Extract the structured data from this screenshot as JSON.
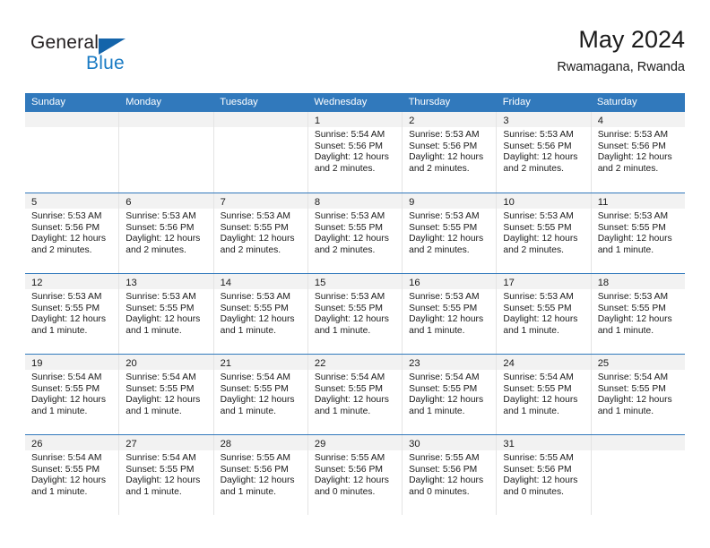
{
  "brand": {
    "name_dark": "General",
    "name_blue": "Blue",
    "dark_color": "#231f20",
    "blue_color": "#1a7bc4"
  },
  "header": {
    "title": "May 2024",
    "subtitle": "Rwamagana, Rwanda"
  },
  "theme": {
    "header_blue": "#3179bc",
    "day_band_gray": "#f2f2f2",
    "cell_border": "#e4e4e4"
  },
  "weekdays": [
    "Sunday",
    "Monday",
    "Tuesday",
    "Wednesday",
    "Thursday",
    "Friday",
    "Saturday"
  ],
  "weeks": [
    [
      {
        "day": "",
        "empty": true
      },
      {
        "day": "",
        "empty": true
      },
      {
        "day": "",
        "empty": true
      },
      {
        "day": "1",
        "sunrise": "Sunrise: 5:54 AM",
        "sunset": "Sunset: 5:56 PM",
        "daylight1": "Daylight: 12 hours",
        "daylight2": "and 2 minutes."
      },
      {
        "day": "2",
        "sunrise": "Sunrise: 5:53 AM",
        "sunset": "Sunset: 5:56 PM",
        "daylight1": "Daylight: 12 hours",
        "daylight2": "and 2 minutes."
      },
      {
        "day": "3",
        "sunrise": "Sunrise: 5:53 AM",
        "sunset": "Sunset: 5:56 PM",
        "daylight1": "Daylight: 12 hours",
        "daylight2": "and 2 minutes."
      },
      {
        "day": "4",
        "sunrise": "Sunrise: 5:53 AM",
        "sunset": "Sunset: 5:56 PM",
        "daylight1": "Daylight: 12 hours",
        "daylight2": "and 2 minutes."
      }
    ],
    [
      {
        "day": "5",
        "sunrise": "Sunrise: 5:53 AM",
        "sunset": "Sunset: 5:56 PM",
        "daylight1": "Daylight: 12 hours",
        "daylight2": "and 2 minutes."
      },
      {
        "day": "6",
        "sunrise": "Sunrise: 5:53 AM",
        "sunset": "Sunset: 5:56 PM",
        "daylight1": "Daylight: 12 hours",
        "daylight2": "and 2 minutes."
      },
      {
        "day": "7",
        "sunrise": "Sunrise: 5:53 AM",
        "sunset": "Sunset: 5:55 PM",
        "daylight1": "Daylight: 12 hours",
        "daylight2": "and 2 minutes."
      },
      {
        "day": "8",
        "sunrise": "Sunrise: 5:53 AM",
        "sunset": "Sunset: 5:55 PM",
        "daylight1": "Daylight: 12 hours",
        "daylight2": "and 2 minutes."
      },
      {
        "day": "9",
        "sunrise": "Sunrise: 5:53 AM",
        "sunset": "Sunset: 5:55 PM",
        "daylight1": "Daylight: 12 hours",
        "daylight2": "and 2 minutes."
      },
      {
        "day": "10",
        "sunrise": "Sunrise: 5:53 AM",
        "sunset": "Sunset: 5:55 PM",
        "daylight1": "Daylight: 12 hours",
        "daylight2": "and 2 minutes."
      },
      {
        "day": "11",
        "sunrise": "Sunrise: 5:53 AM",
        "sunset": "Sunset: 5:55 PM",
        "daylight1": "Daylight: 12 hours",
        "daylight2": "and 1 minute."
      }
    ],
    [
      {
        "day": "12",
        "sunrise": "Sunrise: 5:53 AM",
        "sunset": "Sunset: 5:55 PM",
        "daylight1": "Daylight: 12 hours",
        "daylight2": "and 1 minute."
      },
      {
        "day": "13",
        "sunrise": "Sunrise: 5:53 AM",
        "sunset": "Sunset: 5:55 PM",
        "daylight1": "Daylight: 12 hours",
        "daylight2": "and 1 minute."
      },
      {
        "day": "14",
        "sunrise": "Sunrise: 5:53 AM",
        "sunset": "Sunset: 5:55 PM",
        "daylight1": "Daylight: 12 hours",
        "daylight2": "and 1 minute."
      },
      {
        "day": "15",
        "sunrise": "Sunrise: 5:53 AM",
        "sunset": "Sunset: 5:55 PM",
        "daylight1": "Daylight: 12 hours",
        "daylight2": "and 1 minute."
      },
      {
        "day": "16",
        "sunrise": "Sunrise: 5:53 AM",
        "sunset": "Sunset: 5:55 PM",
        "daylight1": "Daylight: 12 hours",
        "daylight2": "and 1 minute."
      },
      {
        "day": "17",
        "sunrise": "Sunrise: 5:53 AM",
        "sunset": "Sunset: 5:55 PM",
        "daylight1": "Daylight: 12 hours",
        "daylight2": "and 1 minute."
      },
      {
        "day": "18",
        "sunrise": "Sunrise: 5:53 AM",
        "sunset": "Sunset: 5:55 PM",
        "daylight1": "Daylight: 12 hours",
        "daylight2": "and 1 minute."
      }
    ],
    [
      {
        "day": "19",
        "sunrise": "Sunrise: 5:54 AM",
        "sunset": "Sunset: 5:55 PM",
        "daylight1": "Daylight: 12 hours",
        "daylight2": "and 1 minute."
      },
      {
        "day": "20",
        "sunrise": "Sunrise: 5:54 AM",
        "sunset": "Sunset: 5:55 PM",
        "daylight1": "Daylight: 12 hours",
        "daylight2": "and 1 minute."
      },
      {
        "day": "21",
        "sunrise": "Sunrise: 5:54 AM",
        "sunset": "Sunset: 5:55 PM",
        "daylight1": "Daylight: 12 hours",
        "daylight2": "and 1 minute."
      },
      {
        "day": "22",
        "sunrise": "Sunrise: 5:54 AM",
        "sunset": "Sunset: 5:55 PM",
        "daylight1": "Daylight: 12 hours",
        "daylight2": "and 1 minute."
      },
      {
        "day": "23",
        "sunrise": "Sunrise: 5:54 AM",
        "sunset": "Sunset: 5:55 PM",
        "daylight1": "Daylight: 12 hours",
        "daylight2": "and 1 minute."
      },
      {
        "day": "24",
        "sunrise": "Sunrise: 5:54 AM",
        "sunset": "Sunset: 5:55 PM",
        "daylight1": "Daylight: 12 hours",
        "daylight2": "and 1 minute."
      },
      {
        "day": "25",
        "sunrise": "Sunrise: 5:54 AM",
        "sunset": "Sunset: 5:55 PM",
        "daylight1": "Daylight: 12 hours",
        "daylight2": "and 1 minute."
      }
    ],
    [
      {
        "day": "26",
        "sunrise": "Sunrise: 5:54 AM",
        "sunset": "Sunset: 5:55 PM",
        "daylight1": "Daylight: 12 hours",
        "daylight2": "and 1 minute."
      },
      {
        "day": "27",
        "sunrise": "Sunrise: 5:54 AM",
        "sunset": "Sunset: 5:55 PM",
        "daylight1": "Daylight: 12 hours",
        "daylight2": "and 1 minute."
      },
      {
        "day": "28",
        "sunrise": "Sunrise: 5:55 AM",
        "sunset": "Sunset: 5:56 PM",
        "daylight1": "Daylight: 12 hours",
        "daylight2": "and 1 minute."
      },
      {
        "day": "29",
        "sunrise": "Sunrise: 5:55 AM",
        "sunset": "Sunset: 5:56 PM",
        "daylight1": "Daylight: 12 hours",
        "daylight2": "and 0 minutes."
      },
      {
        "day": "30",
        "sunrise": "Sunrise: 5:55 AM",
        "sunset": "Sunset: 5:56 PM",
        "daylight1": "Daylight: 12 hours",
        "daylight2": "and 0 minutes."
      },
      {
        "day": "31",
        "sunrise": "Sunrise: 5:55 AM",
        "sunset": "Sunset: 5:56 PM",
        "daylight1": "Daylight: 12 hours",
        "daylight2": "and 0 minutes."
      },
      {
        "day": "",
        "empty": true
      }
    ]
  ]
}
